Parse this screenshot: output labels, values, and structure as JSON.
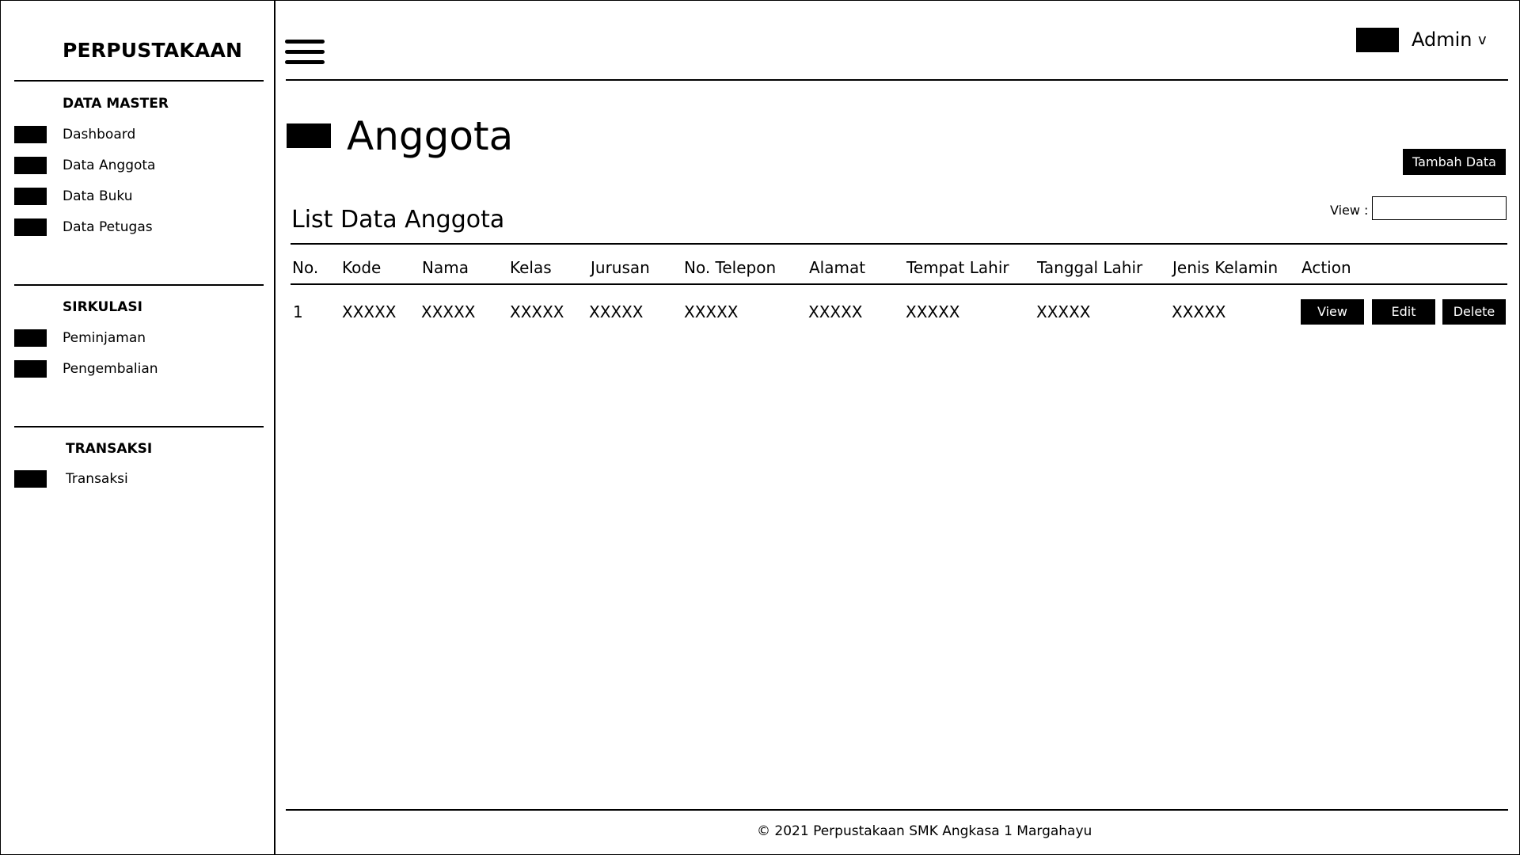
{
  "sidebar": {
    "brand": "PERPUSTAKAAN",
    "sections": [
      {
        "title": "DATA MASTER",
        "items": [
          {
            "label": "Dashboard",
            "icon": "dashboard-icon"
          },
          {
            "label": "Data Anggota",
            "icon": "members-icon"
          },
          {
            "label": "Data Buku",
            "icon": "books-icon"
          },
          {
            "label": "Data Petugas",
            "icon": "staff-icon"
          }
        ]
      },
      {
        "title": "SIRKULASI",
        "items": [
          {
            "label": "Peminjaman",
            "icon": "borrow-icon"
          },
          {
            "label": "Pengembalian",
            "icon": "return-icon"
          }
        ]
      },
      {
        "title": "TRANSAKSI",
        "items": [
          {
            "label": "Transaksi",
            "icon": "transaction-icon"
          }
        ]
      }
    ]
  },
  "header": {
    "menu_icon": "hamburger-menu-icon",
    "user": {
      "name": "Admin",
      "chevron": "v"
    }
  },
  "main": {
    "page_title": "Anggota",
    "add_button": "Tambah Data",
    "list_title": "List Data Anggota",
    "view_label": "View :",
    "view_value": "",
    "table": {
      "columns": [
        "No.",
        "Kode",
        "Nama",
        "Kelas",
        "Jurusan",
        "No. Telepon",
        "Alamat",
        "Tempat Lahir",
        "Tanggal Lahir",
        "Jenis Kelamin",
        "Action"
      ],
      "rows": [
        {
          "cells": [
            "1",
            "XXXXX",
            "XXXXX",
            "XXXXX",
            "XXXXX",
            "XXXXX",
            "XXXXX",
            "XXXXX",
            "XXXXX",
            "XXXXX"
          ],
          "actions": [
            "View",
            "Edit",
            "Delete"
          ]
        }
      ]
    }
  },
  "footer": {
    "text": "© 2021 Perpustakaan SMK Angkasa 1 Margahayu"
  },
  "colors": {
    "background": "#ffffff",
    "ink": "#000000",
    "button_bg": "#000000",
    "button_text": "#ffffff"
  }
}
